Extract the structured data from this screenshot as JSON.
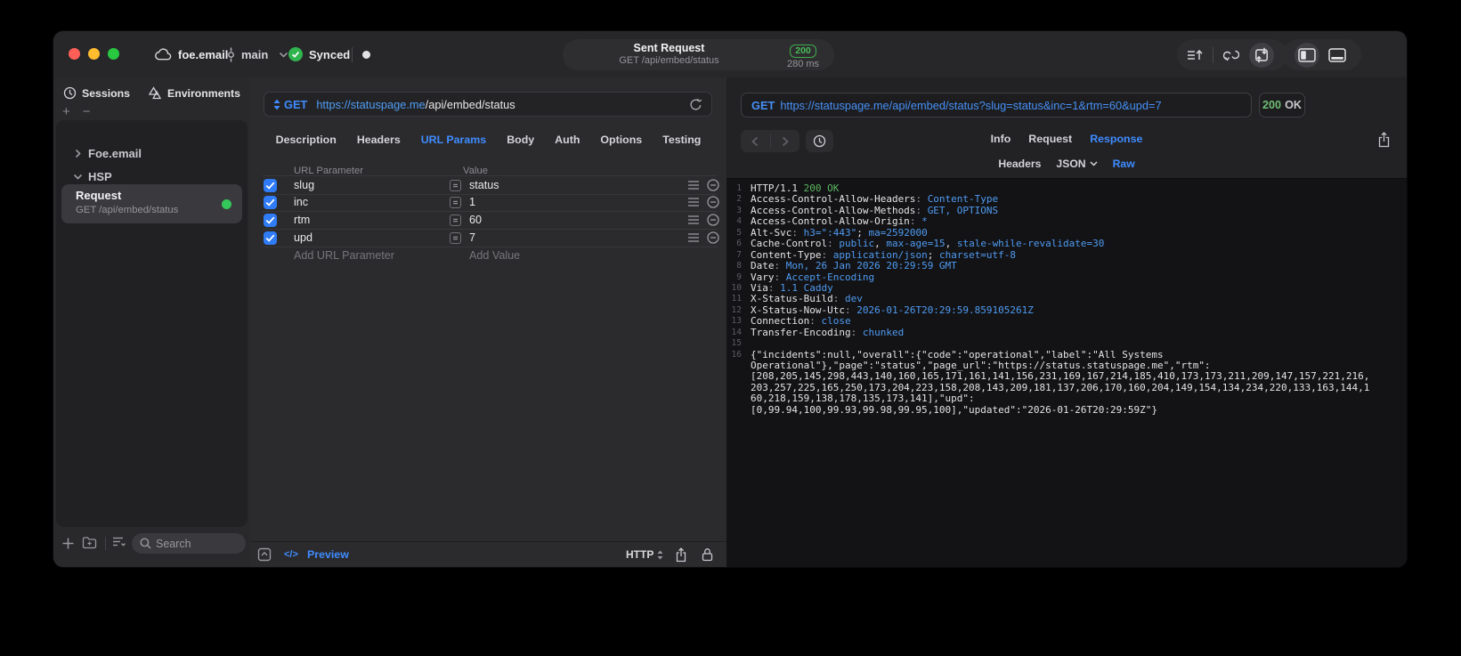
{
  "titlebar": {
    "project": "foe.email",
    "branch": "main",
    "sync_label": "Synced",
    "request_pill": {
      "title": "Sent Request",
      "method_path": "GET /api/embed/status",
      "status_code": "200",
      "duration": "280 ms"
    }
  },
  "sidebar": {
    "tabs": [
      {
        "label": "Sessions"
      },
      {
        "label": "Environments"
      }
    ],
    "tree": [
      {
        "label": "Foe.email"
      },
      {
        "label": "HSP"
      }
    ],
    "request_item": {
      "title": "Request",
      "subtitle": "GET /api/embed/status"
    },
    "search_placeholder": "Search"
  },
  "request_panel": {
    "method": "GET",
    "url_host": "https://statuspage.me",
    "url_path": "/api/embed/status",
    "tabs": [
      "Description",
      "Headers",
      "URL Params",
      "Body",
      "Auth",
      "Options",
      "Testing"
    ],
    "active_tab": "URL Params",
    "table": {
      "col_param": "URL Parameter",
      "col_value": "Value",
      "rows": [
        {
          "name": "slug",
          "value": "status",
          "enabled": true
        },
        {
          "name": "inc",
          "value": "1",
          "enabled": true
        },
        {
          "name": "rtm",
          "value": "60",
          "enabled": true
        },
        {
          "name": "upd",
          "value": "7",
          "enabled": true
        }
      ],
      "add_param_label": "Add URL Parameter",
      "add_value_label": "Add Value"
    },
    "footer": {
      "code_glyph": "</>",
      "preview_label": "Preview",
      "protocol": "HTTP"
    }
  },
  "response_panel": {
    "request_line": {
      "method": "GET",
      "url": "https://statuspage.me/api/embed/status?slug=status&inc=1&rtm=60&upd=7"
    },
    "status_badge": {
      "code": "200",
      "text": "OK"
    },
    "tabs": [
      "Info",
      "Request",
      "Response"
    ],
    "active_tab": "Response",
    "subtabs": [
      "Headers",
      "JSON",
      "Raw"
    ],
    "active_subtab": "Raw",
    "body_lines": [
      {
        "n": "1",
        "p": [
          {
            "t": "HTTP/1.1 ",
            "c": "w"
          },
          {
            "t": "200 OK",
            "c": "g"
          }
        ]
      },
      {
        "n": "2",
        "p": [
          {
            "t": "Access-Control-Allow-Headers",
            "c": "w"
          },
          {
            "t": ": ",
            "c": "d"
          },
          {
            "t": "Content-Type",
            "c": "b"
          }
        ]
      },
      {
        "n": "3",
        "p": [
          {
            "t": "Access-Control-Allow-Methods",
            "c": "w"
          },
          {
            "t": ": ",
            "c": "d"
          },
          {
            "t": "GET, OPTIONS",
            "c": "b"
          }
        ]
      },
      {
        "n": "4",
        "p": [
          {
            "t": "Access-Control-Allow-Origin",
            "c": "w"
          },
          {
            "t": ": ",
            "c": "d"
          },
          {
            "t": "*",
            "c": "b"
          }
        ]
      },
      {
        "n": "5",
        "p": [
          {
            "t": "Alt-Svc",
            "c": "w"
          },
          {
            "t": ": ",
            "c": "d"
          },
          {
            "t": "h3=\":443\"",
            "c": "b"
          },
          {
            "t": "; ",
            "c": "w"
          },
          {
            "t": "ma=2592000",
            "c": "b"
          }
        ]
      },
      {
        "n": "6",
        "p": [
          {
            "t": "Cache-Control",
            "c": "w"
          },
          {
            "t": ": ",
            "c": "d"
          },
          {
            "t": "public",
            "c": "b"
          },
          {
            "t": ", ",
            "c": "w"
          },
          {
            "t": "max-age=15",
            "c": "b"
          },
          {
            "t": ", ",
            "c": "w"
          },
          {
            "t": "stale-while-revalidate=30",
            "c": "b"
          }
        ]
      },
      {
        "n": "7",
        "p": [
          {
            "t": "Content-Type",
            "c": "w"
          },
          {
            "t": ": ",
            "c": "d"
          },
          {
            "t": "application/json",
            "c": "b"
          },
          {
            "t": "; ",
            "c": "w"
          },
          {
            "t": "charset=utf-8",
            "c": "b"
          }
        ]
      },
      {
        "n": "8",
        "p": [
          {
            "t": "Date",
            "c": "w"
          },
          {
            "t": ": ",
            "c": "d"
          },
          {
            "t": "Mon, 26 Jan 2026 20:29:59 GMT",
            "c": "b"
          }
        ]
      },
      {
        "n": "9",
        "p": [
          {
            "t": "Vary",
            "c": "w"
          },
          {
            "t": ": ",
            "c": "d"
          },
          {
            "t": "Accept-Encoding",
            "c": "b"
          }
        ]
      },
      {
        "n": "10",
        "p": [
          {
            "t": "Via",
            "c": "w"
          },
          {
            "t": ": ",
            "c": "d"
          },
          {
            "t": "1.1 Caddy",
            "c": "b"
          }
        ]
      },
      {
        "n": "11",
        "p": [
          {
            "t": "X-Status-Build",
            "c": "w"
          },
          {
            "t": ": ",
            "c": "d"
          },
          {
            "t": "dev",
            "c": "b"
          }
        ]
      },
      {
        "n": "12",
        "p": [
          {
            "t": "X-Status-Now-Utc",
            "c": "w"
          },
          {
            "t": ": ",
            "c": "d"
          },
          {
            "t": "2026-01-26T20:29:59.859105261Z",
            "c": "b"
          }
        ]
      },
      {
        "n": "13",
        "p": [
          {
            "t": "Connection",
            "c": "w"
          },
          {
            "t": ": ",
            "c": "d"
          },
          {
            "t": "close",
            "c": "b"
          }
        ]
      },
      {
        "n": "14",
        "p": [
          {
            "t": "Transfer-Encoding",
            "c": "w"
          },
          {
            "t": ": ",
            "c": "d"
          },
          {
            "t": "chunked",
            "c": "b"
          }
        ]
      },
      {
        "n": "15",
        "p": []
      },
      {
        "n": "16",
        "p": [
          {
            "t": "{\"incidents\":null,\"overall\":{\"code\":\"operational\",\"label\":\"All Systems",
            "c": "w"
          }
        ]
      },
      {
        "n": "",
        "p": [
          {
            "t": "Operational\"},\"page\":\"status\",\"page_url\":\"https://status.statuspage.me\",\"rtm\":",
            "c": "w"
          }
        ]
      },
      {
        "n": "",
        "p": [
          {
            "t": "[208,205,145,298,443,140,160,165,171,161,141,156,231,169,167,214,185,410,173,173,211,209,147,157,221,216,",
            "c": "w"
          }
        ]
      },
      {
        "n": "",
        "p": [
          {
            "t": "203,257,225,165,250,173,204,223,158,208,143,209,181,137,206,170,160,204,149,154,134,234,220,133,163,144,1",
            "c": "w"
          }
        ]
      },
      {
        "n": "",
        "p": [
          {
            "t": "60,218,159,138,178,135,173,141],\"upd\":",
            "c": "w"
          }
        ]
      },
      {
        "n": "",
        "p": [
          {
            "t": "[0,99.94,100,99.93,99.98,99.95,100],\"updated\":\"2026-01-26T20:29:59Z\"}",
            "c": "w"
          }
        ]
      }
    ]
  },
  "colors": {
    "accent_blue": "#3f8cff",
    "value_blue": "#4f9bf0",
    "success_green": "#34c759",
    "checkbox_blue": "#2f7cf6"
  }
}
